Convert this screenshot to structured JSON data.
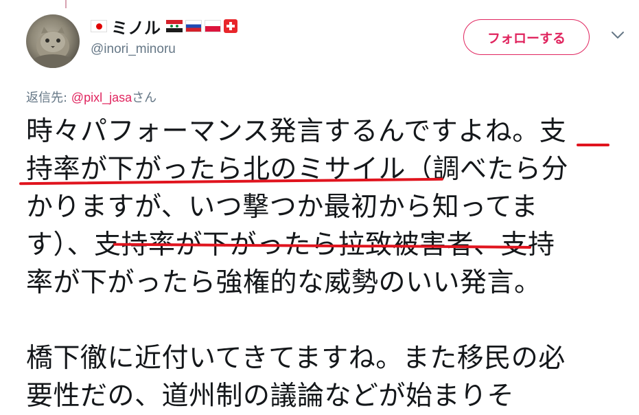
{
  "user": {
    "display_name": "ミノル",
    "handle": "@inori_minoru",
    "flags": [
      "japan-flag",
      "syria-flag",
      "russia-flag",
      "poland-flag",
      "switzerland-flag"
    ]
  },
  "follow_button": {
    "label": "フォローする"
  },
  "reply": {
    "prefix": "返信先: ",
    "mention": "@pixl_jasa",
    "suffix": "さん"
  },
  "tweet": {
    "lines": [
      "時々パフォーマンス発言するんですよね。支",
      "持率が下がったら北のミサイル（調べたら分",
      "かりますが、いつ撃つか最初から知ってま",
      "す）、支持率が下がったら拉致被害者、支持",
      "率が下がったら強権的な威勢のいい発言。",
      "",
      "橋下徹に近付いてきてますね。また移民の必",
      "要性だの、道州制の議論などが始まりそ"
    ]
  },
  "colors": {
    "accent": "#e0245e",
    "text": "#14171a",
    "secondary": "#657786",
    "annotation": "#e0141e"
  }
}
